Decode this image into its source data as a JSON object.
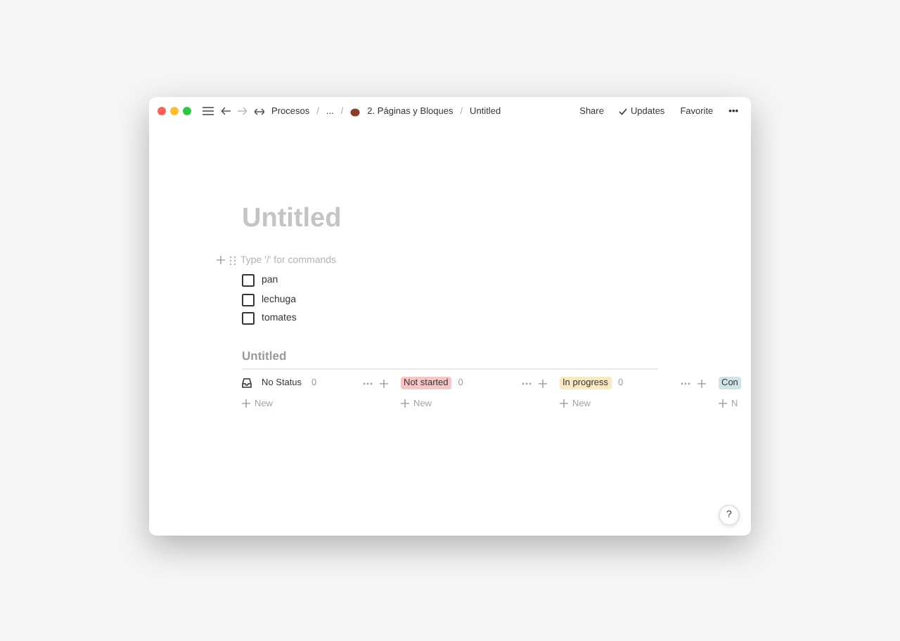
{
  "titlebar": {
    "separator": "/",
    "breadcrumbs": [
      {
        "kind": "link",
        "label": "Procesos"
      },
      {
        "kind": "plain",
        "label": "..."
      },
      {
        "kind": "page",
        "label": "2. Páginas y Bloques"
      },
      {
        "kind": "plain",
        "label": "Untitled"
      }
    ],
    "actions": [
      {
        "kind": "text",
        "label": "Share"
      },
      {
        "kind": "check",
        "label": "Updates"
      },
      {
        "kind": "text",
        "label": "Favorite"
      },
      {
        "kind": "more",
        "label": "•••"
      }
    ]
  },
  "page": {
    "title": "Untitled",
    "block_placeholder": "Type '/' for commands",
    "todos": [
      {
        "label": "pan",
        "checked": false
      },
      {
        "label": "lechuga",
        "checked": false
      },
      {
        "label": "tomates",
        "checked": false
      }
    ],
    "board": {
      "title": "Untitled",
      "columns": [
        {
          "label": "No Status",
          "count": "0",
          "color": "#ffffff",
          "new_label": "New"
        },
        {
          "label": "Not started",
          "count": "0",
          "color": "#f4c6c6",
          "new_label": "New"
        },
        {
          "label": "In progress",
          "count": "0",
          "color": "#f8e8c4",
          "new_label": "New"
        },
        {
          "label": "Con",
          "color": "#cfe5e5",
          "new_label": "N"
        }
      ]
    }
  },
  "help": "?"
}
